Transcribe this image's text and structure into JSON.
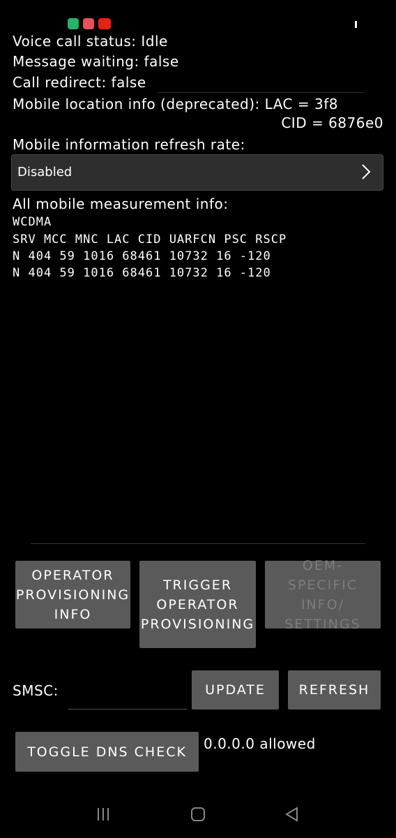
{
  "status_bar": {
    "icons": [
      "green-app-icon",
      "red-pin-icon",
      "youtube-icon"
    ],
    "battery_icon": "battery-icon"
  },
  "info": {
    "voice_call_status": "Voice call status: Idle",
    "message_waiting": "Message waiting: false",
    "call_redirect": "Call redirect: false",
    "mobile_location_info": "Mobile location info (deprecated): LAC = 3f8",
    "cid": "CID = 6876e0",
    "refresh_rate_label": "Mobile information refresh rate:"
  },
  "refresh_spinner": {
    "selected": "Disabled"
  },
  "measurement": {
    "title": "All mobile measurement info:",
    "technology": "WCDMA",
    "header": "SRV MCC MNC LAC  CID  UARFCN PSC RSCP",
    "rows": [
      "N  404 59  1016 68461 10732 16 -120",
      "N  404 59  1016 68461 10732 16 -120"
    ]
  },
  "buttons": {
    "operator_provisioning_info": "OPERATOR PROVISIONING INFO",
    "trigger_operator_provisioning": "TRIGGER OPERATOR PROVISIONING",
    "oem_specific_info": "OEM-SPECIFIC INFO/ SETTINGS",
    "update": "UPDATE",
    "refresh": "REFRESH",
    "toggle_dns_check": "TOGGLE DNS CHECK"
  },
  "smsc": {
    "label": "SMSC:",
    "value": ""
  },
  "dns_status": "0.0.0.0 allowed",
  "colors": {
    "background": "#000000",
    "button": "#5a5a5a",
    "spinner": "#2e2e2e"
  }
}
